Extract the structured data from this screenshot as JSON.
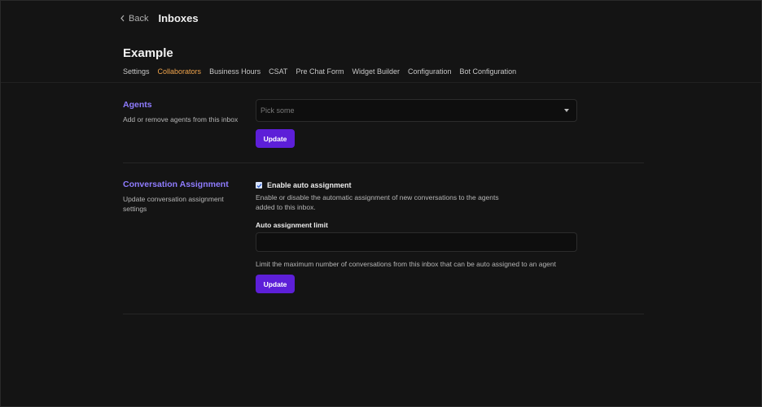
{
  "header": {
    "back_label": "Back",
    "title": "Inboxes"
  },
  "page": {
    "title": "Example"
  },
  "tabs": [
    {
      "label": "Settings",
      "active": false
    },
    {
      "label": "Collaborators",
      "active": true
    },
    {
      "label": "Business Hours",
      "active": false
    },
    {
      "label": "CSAT",
      "active": false
    },
    {
      "label": "Pre Chat Form",
      "active": false
    },
    {
      "label": "Widget Builder",
      "active": false
    },
    {
      "label": "Configuration",
      "active": false
    },
    {
      "label": "Bot Configuration",
      "active": false
    }
  ],
  "agents": {
    "title": "Agents",
    "description": "Add or remove agents from this inbox",
    "select_placeholder": "Pick some",
    "update_label": "Update"
  },
  "assignment": {
    "title": "Conversation Assignment",
    "description": "Update conversation assignment settings",
    "checkbox_label": "Enable auto assignment",
    "checkbox_checked": true,
    "checkbox_help": "Enable or disable the automatic assignment of new conversations to the agents added to this inbox.",
    "limit_label": "Auto assignment limit",
    "limit_value": "",
    "limit_help": "Limit the maximum number of conversations from this inbox that can be auto assigned to an agent",
    "update_label": "Update"
  },
  "colors": {
    "accent": "#5d1fd8",
    "section_title": "#8f7cff",
    "active_tab": "#f0a44c",
    "background": "#141414"
  }
}
